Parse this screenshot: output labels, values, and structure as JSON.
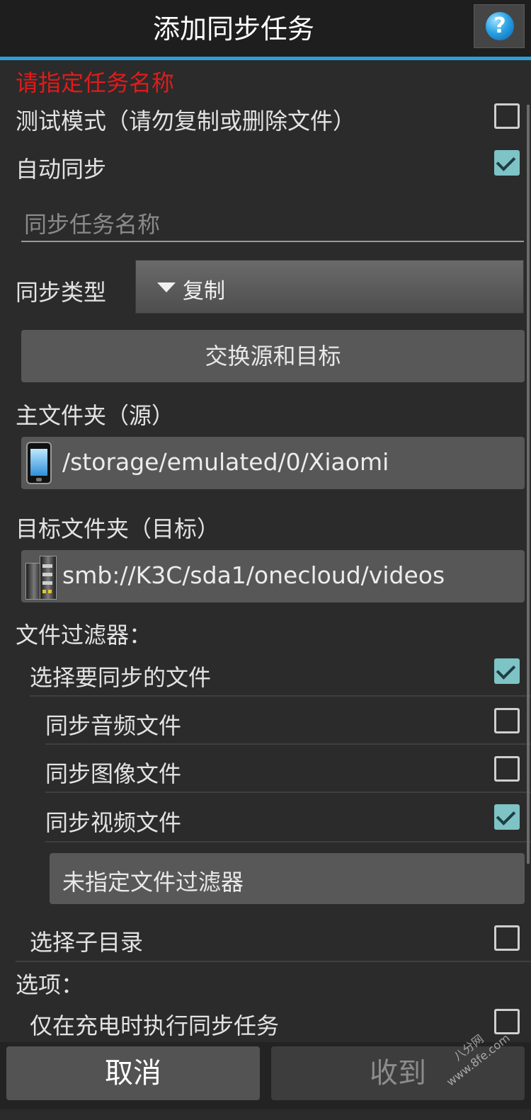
{
  "title": "添加同步任务",
  "help_glyph": "?",
  "error_text": "请指定任务名称",
  "test_mode": {
    "label": "测试模式（请勿复制或删除文件）",
    "checked": false
  },
  "auto_sync": {
    "label": "自动同步",
    "checked": true
  },
  "task_name": {
    "placeholder": "同步任务名称",
    "value": ""
  },
  "sync_type": {
    "label": "同步类型",
    "value": "复制"
  },
  "swap_button": "交换源和目标",
  "source": {
    "label": "主文件夹（源）",
    "path": "/storage/emulated/0/Xiaomi",
    "icon": "phone-icon"
  },
  "target": {
    "label": "目标文件夹（目标）",
    "path": "smb://K3C/sda1/onecloud/videos",
    "icon": "server-icon"
  },
  "file_filter": {
    "heading": "文件过滤器：",
    "select_files": {
      "label": "选择要同步的文件",
      "checked": true
    },
    "audio": {
      "label": "同步音频文件",
      "checked": false
    },
    "image": {
      "label": "同步图像文件",
      "checked": false
    },
    "video": {
      "label": "同步视频文件",
      "checked": true
    },
    "filter_button": "未指定文件过滤器",
    "subdirs": {
      "label": "选择子目录",
      "checked": false
    }
  },
  "options": {
    "heading": "选项：",
    "charging_only": {
      "label": "仅在充电时执行同步任务",
      "checked": false
    }
  },
  "footer": {
    "cancel": "取消",
    "ok": "收到"
  },
  "watermark": {
    "line1": "八分网",
    "line2": "www.8fe.com"
  },
  "colors": {
    "accent": "#2e9fd6",
    "error": "#e01b1b",
    "checkbox_checked": "#7ec3c6"
  }
}
